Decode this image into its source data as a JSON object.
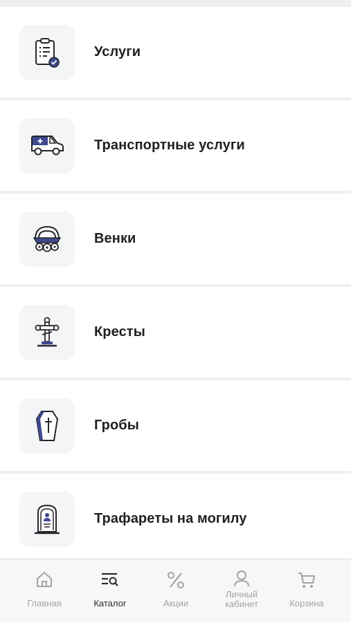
{
  "catalog": {
    "items": [
      {
        "label": "Услуги",
        "icon": "clipboard-check-icon"
      },
      {
        "label": "Транспортные услуги",
        "icon": "hearse-car-icon"
      },
      {
        "label": "Венки",
        "icon": "wreath-icon"
      },
      {
        "label": "Кресты",
        "icon": "cross-icon"
      },
      {
        "label": "Гробы",
        "icon": "coffin-icon"
      },
      {
        "label": "Трафареты на могилу",
        "icon": "gravestone-icon"
      }
    ]
  },
  "tabbar": {
    "items": [
      {
        "label": "Главная",
        "icon": "home-icon",
        "active": false
      },
      {
        "label": "Каталог",
        "icon": "catalog-search-icon",
        "active": true
      },
      {
        "label": "Акции",
        "icon": "percent-icon",
        "active": false
      },
      {
        "label": "Личный кабинет",
        "icon": "user-icon",
        "active": false
      },
      {
        "label": "Корзина",
        "icon": "cart-icon",
        "active": false
      }
    ]
  },
  "colors": {
    "accent": "#3d4a8f",
    "text": "#1f1f24",
    "inactive": "#a3a3a8",
    "icon_bg": "#f4f5f7"
  }
}
